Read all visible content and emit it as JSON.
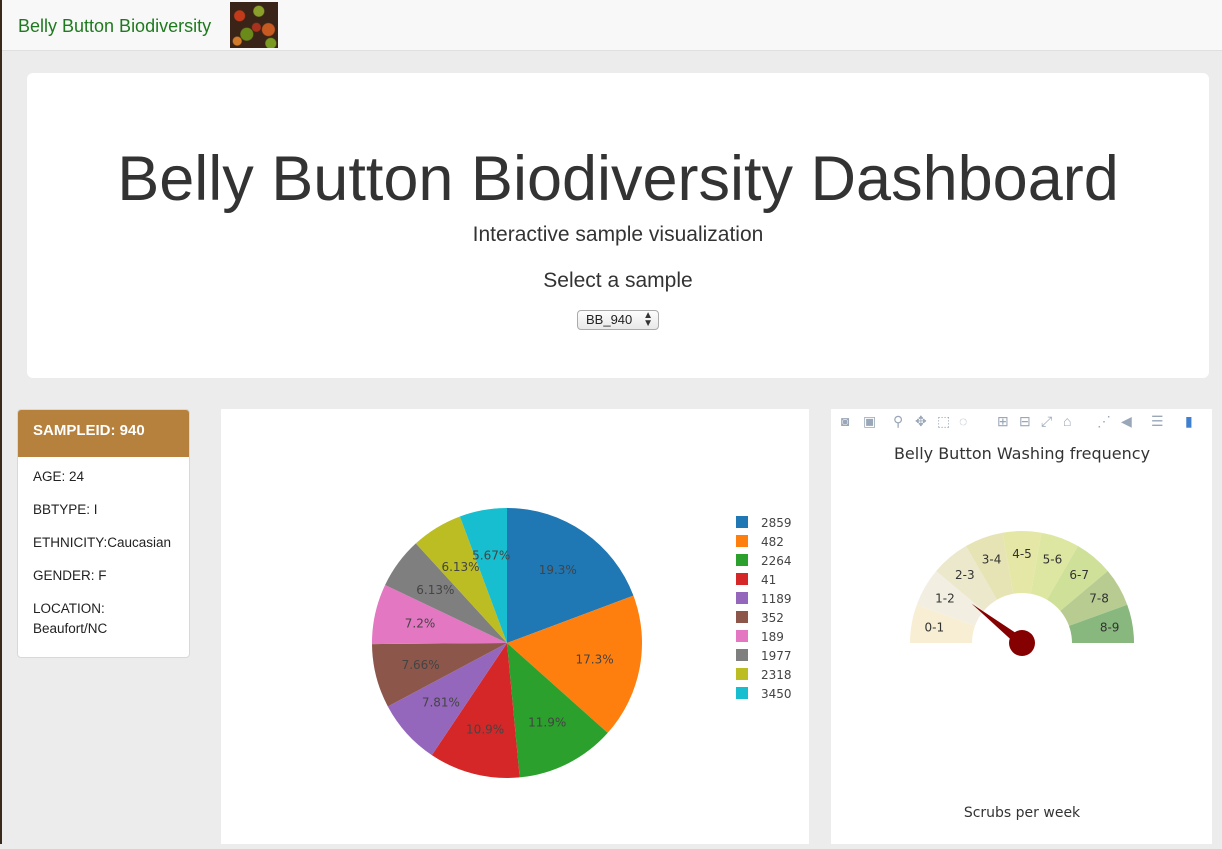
{
  "navbar": {
    "brand": "Belly Button Biodiversity"
  },
  "header": {
    "title": "Belly Button Biodiversity Dashboard",
    "subtitle": "Interactive sample visualization",
    "select_label": "Select a sample",
    "selected_sample": "BB_940"
  },
  "metadata": {
    "heading": "SAMPLEID: 940",
    "age": "AGE: 24",
    "bbtype": "BBTYPE: I",
    "ethnicity": "ETHNICITY:Caucasian",
    "gender": "GENDER: F",
    "location_label": "LOCATION:",
    "location_value": "Beaufort/NC"
  },
  "colors": {
    "accent": "#b5813c",
    "brand": "#1f7a1f",
    "needle": "#850000"
  },
  "modebar_icons": [
    "camera-icon",
    "save-icon",
    "zoom-icon",
    "pan-icon",
    "box-select-icon",
    "lasso-icon",
    "zoom-in-icon",
    "zoom-out-icon",
    "autoscale-icon",
    "reset-axes-icon",
    "spike-lines-icon",
    "hover-closest-icon",
    "hover-compare-icon",
    "plotly-logo-icon"
  ],
  "chart_data": [
    {
      "type": "pie",
      "labels": [
        "2859",
        "482",
        "2264",
        "41",
        "1189",
        "352",
        "189",
        "1977",
        "2318",
        "3450"
      ],
      "values": [
        19.3,
        17.3,
        11.9,
        10.9,
        7.81,
        7.66,
        7.2,
        6.13,
        6.13,
        5.67
      ],
      "value_labels": [
        "19.3%",
        "17.3%",
        "11.9%",
        "10.9%",
        "7.81%",
        "7.66%",
        "7.2%",
        "6.13%",
        "6.13%",
        "5.67%"
      ],
      "slice_labels": [
        "2859",
        "482",
        "2264",
        "41",
        "1189",
        "352",
        "189",
        "1977",
        "2318",
        "3450"
      ],
      "colors": [
        "#1f77b4",
        "#ff7f0e",
        "#2ca02c",
        "#d62728",
        "#9467bd",
        "#8c564b",
        "#e377c2",
        "#7f7f7f",
        "#bcbd22",
        "#17becf"
      ],
      "legend_position": "right"
    },
    {
      "type": "gauge",
      "title": "Belly Button Washing frequency",
      "xlabel": "Scrubs per week",
      "segments": [
        "0-1",
        "1-2",
        "2-3",
        "3-4",
        "4-5",
        "5-6",
        "6-7",
        "7-8",
        "8-9"
      ],
      "segment_colors": [
        "#f7eed4",
        "#f2efe2",
        "#ebe8cc",
        "#e6e4b5",
        "#e4e7a5",
        "#dde7a1",
        "#cfe099",
        "#b8cc92",
        "#88b87e"
      ],
      "value": 2,
      "range": [
        0,
        9
      ]
    }
  ]
}
